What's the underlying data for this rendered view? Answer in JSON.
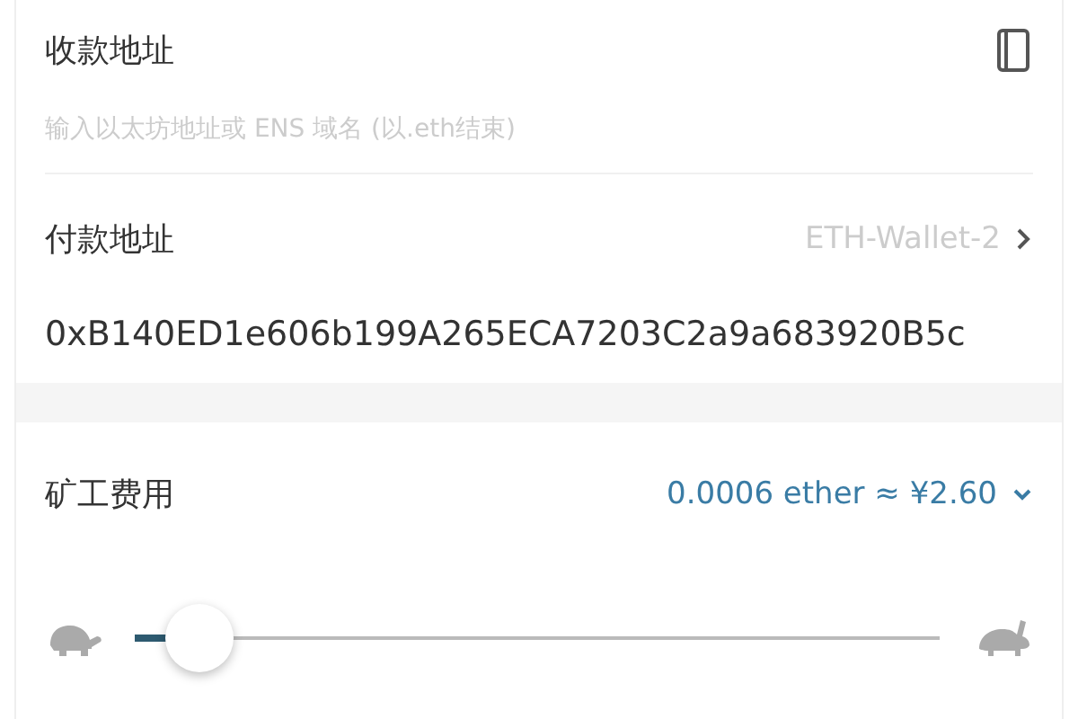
{
  "recipient": {
    "label": "收款地址",
    "placeholder": "输入以太坊地址或 ENS 域名 (以.eth结束)"
  },
  "payer": {
    "label": "付款地址",
    "wallet": "ETH-Wallet-2",
    "address": "0xB140ED1e606b199A265ECA7203C2a9a683920B5c"
  },
  "fee": {
    "label": "矿工费用",
    "value": "0.0006 ether ≈ ¥2.60",
    "slider": {
      "level": 0.08
    }
  }
}
